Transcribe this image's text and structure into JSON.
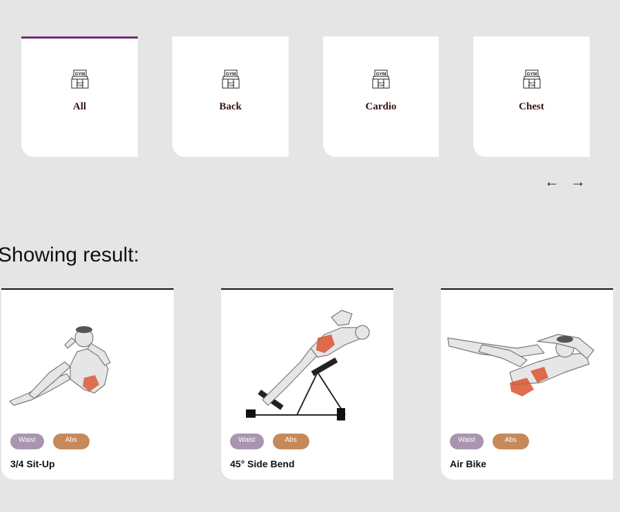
{
  "categories": [
    {
      "label": "All",
      "icon": "gym-icon",
      "active": true
    },
    {
      "label": "Back",
      "icon": "gym-icon",
      "active": false
    },
    {
      "label": "Cardio",
      "icon": "gym-icon",
      "active": false
    },
    {
      "label": "Chest",
      "icon": "gym-icon",
      "active": false
    }
  ],
  "pager": {
    "prev_icon": "arrow-left-icon",
    "next_icon": "arrow-right-icon",
    "prev_glyph": "←",
    "next_glyph": "→"
  },
  "results": {
    "heading": "Showing result:",
    "cards": [
      {
        "name": "3/4 Sit-Up",
        "tags": [
          "Waist",
          "Abs"
        ]
      },
      {
        "name": "45° Side Bend",
        "tags": [
          "Waist",
          "Abs"
        ]
      },
      {
        "name": "Air Bike",
        "tags": [
          "Waist",
          "Abs"
        ]
      }
    ]
  },
  "colors": {
    "accent": "#6b2a6b",
    "waist_tag": "#a995b0",
    "abs_tag": "#c6895a",
    "muscle_highlight": "#d9532f"
  }
}
